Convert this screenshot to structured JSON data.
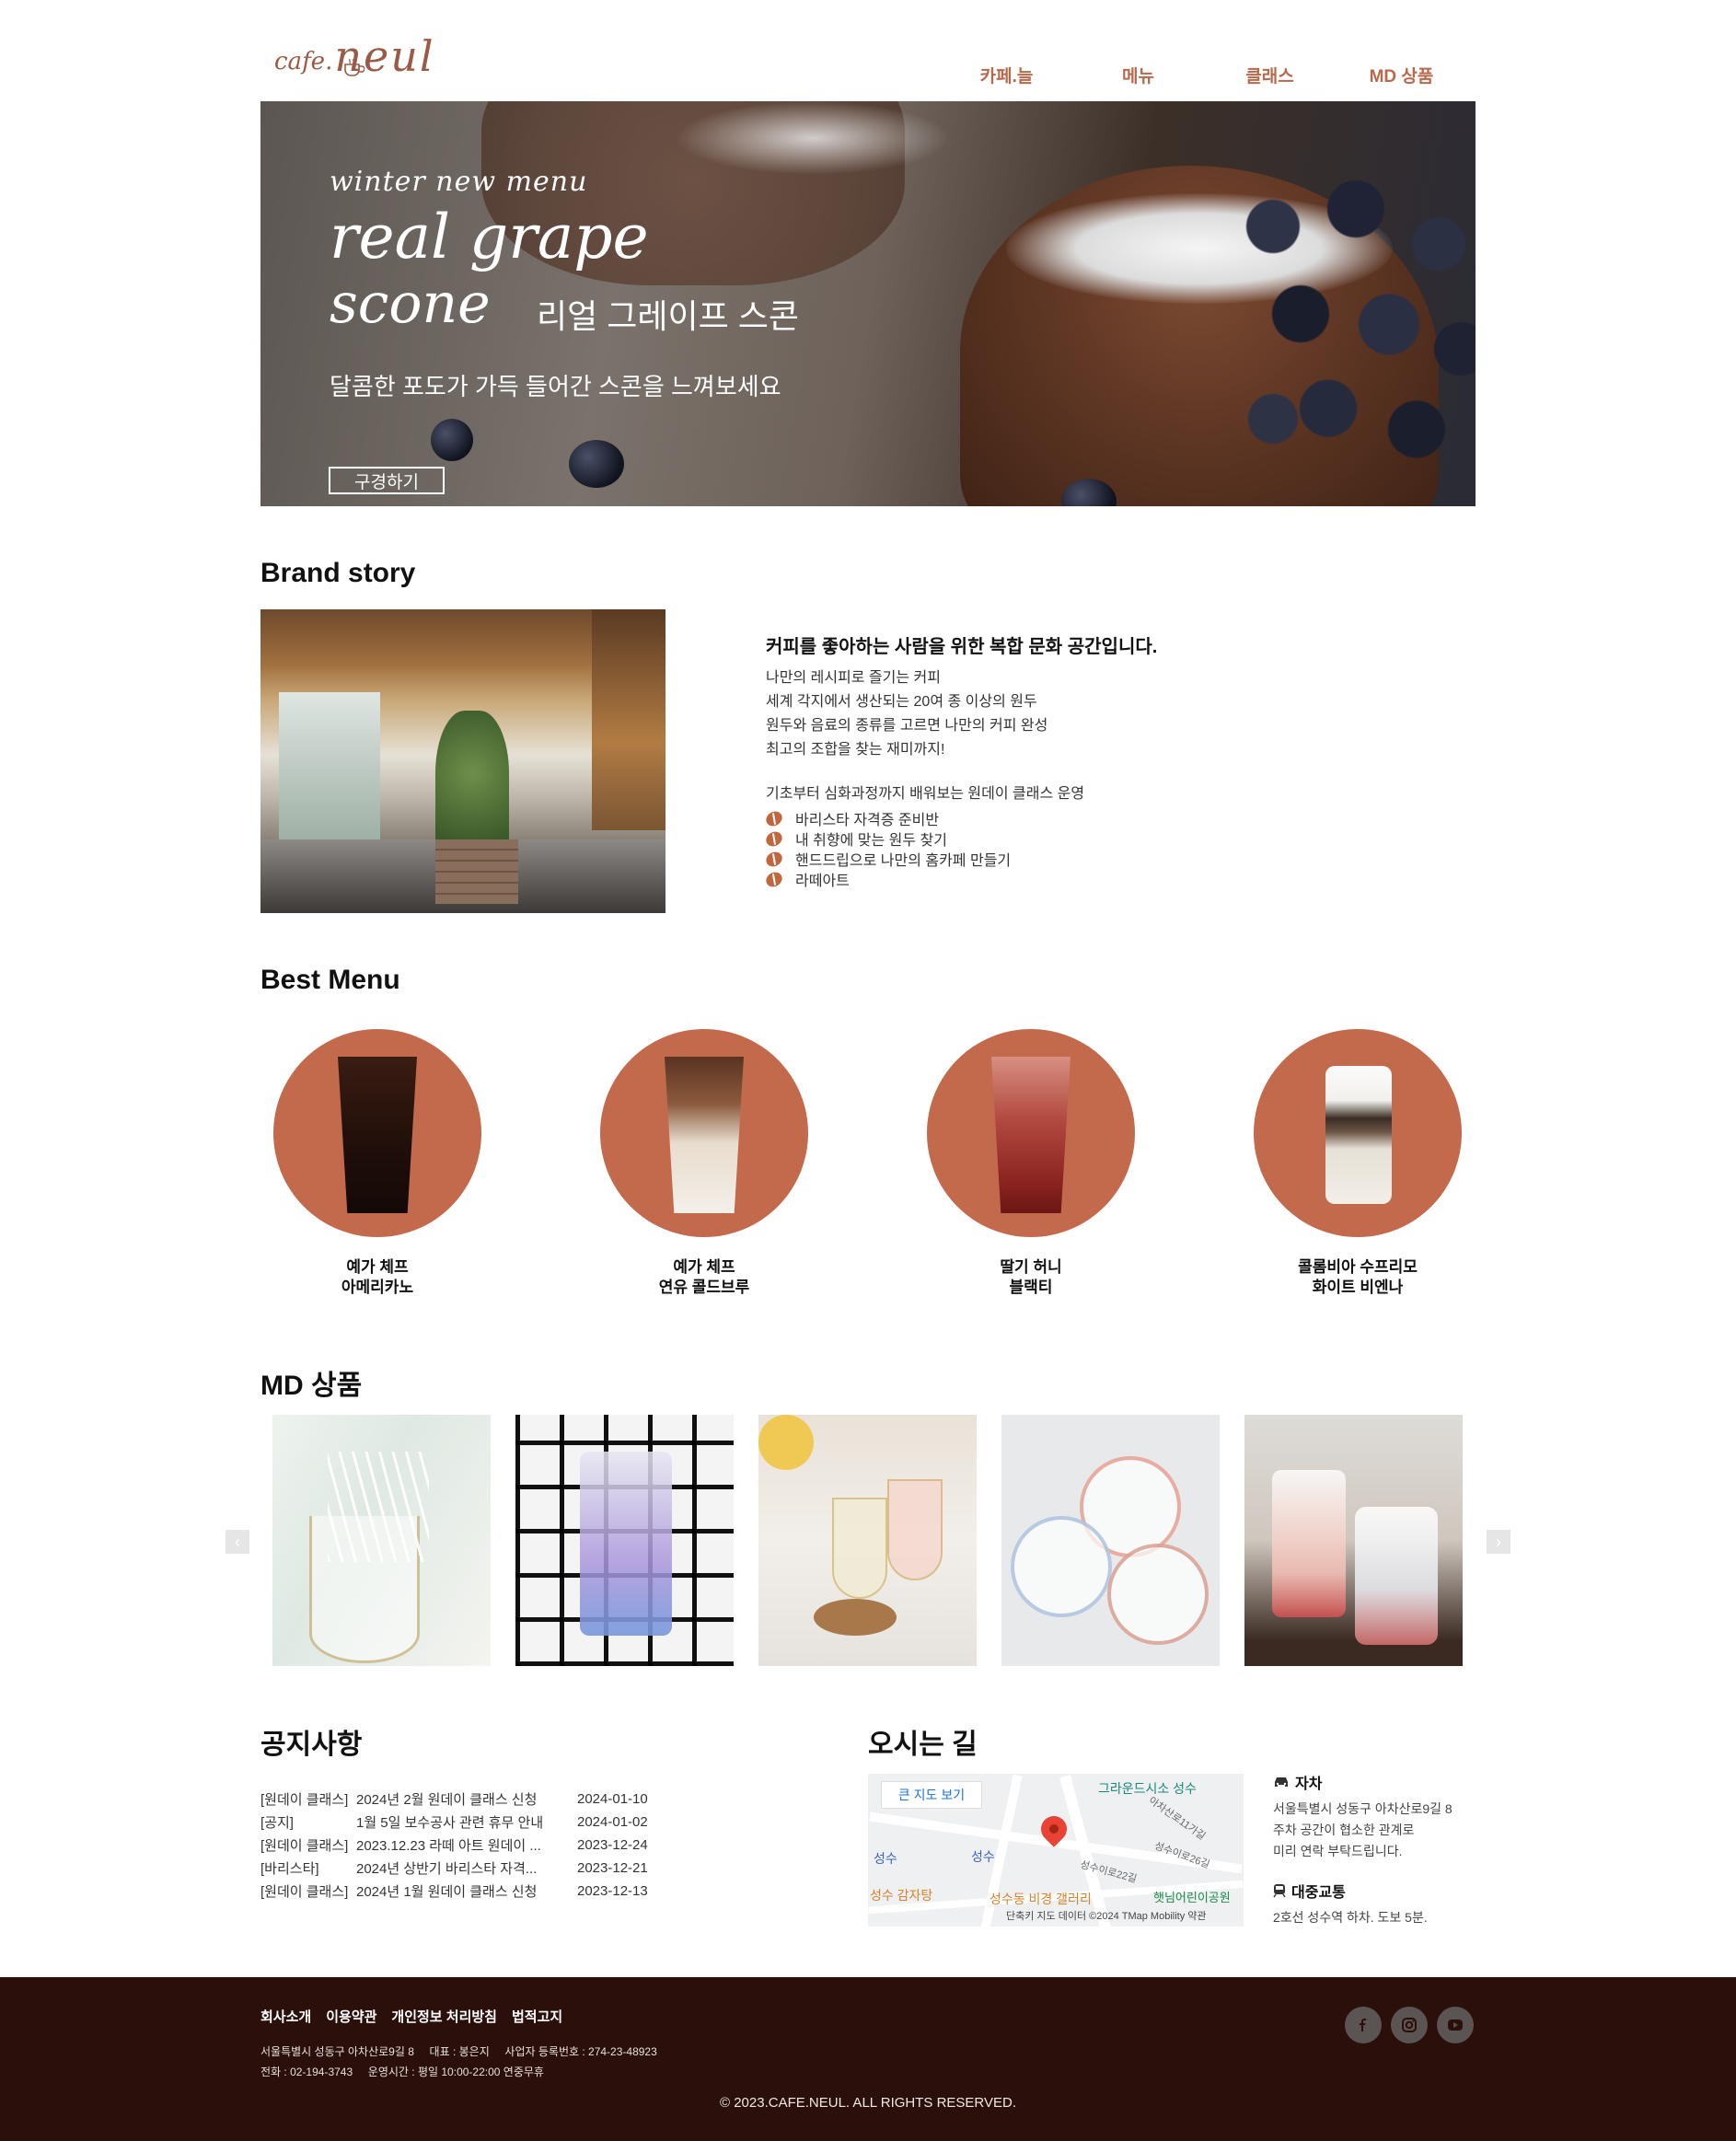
{
  "header": {
    "logo_small": "cafe.",
    "logo_big": "neul",
    "nav": [
      "카페.늘",
      "메뉴",
      "클래스",
      "MD 상품"
    ]
  },
  "hero": {
    "line1": "winter new menu",
    "line2": "real grape",
    "line3": "scone",
    "line3_ko": "리얼 그레이프 스콘",
    "subtitle": "달콤한 포도가 가득 들어간 스콘을 느껴보세요",
    "button": "구경하기"
  },
  "brand": {
    "title": "Brand story",
    "headline": "커피를 좋아하는 사람을 위한 복합 문화 공간입니다.",
    "lines": [
      "나만의 레시피로 즐기는 커피",
      "세계 각지에서 생산되는 20여 종 이상의 원두",
      "원두와 음료의 종류를 고르면 나만의 커피 완성",
      "최고의 조합을 찾는 재미까지!"
    ],
    "class_intro": "기초부터 심화과정까지 배워보는 원데이 클래스 운영",
    "classes": [
      "바리스타 자격증 준비반",
      "내 취향에 맞는 원두 찾기",
      "핸드드립으로 나만의 홈카페 만들기",
      "라떼아트"
    ]
  },
  "best_menu": {
    "title": "Best Menu",
    "items": [
      {
        "name1": "예가 체프",
        "name2": "아메리카노"
      },
      {
        "name1": "예가 체프",
        "name2": "연유 콜드브루"
      },
      {
        "name1": "딸기 허니",
        "name2": "블랙티"
      },
      {
        "name1": "콜롬비아 수프리모",
        "name2": "화이트 비엔나"
      }
    ]
  },
  "md": {
    "title": "MD 상품",
    "prev_icon": "‹",
    "next_icon": "›"
  },
  "notice": {
    "title": "공지사항",
    "rows": [
      {
        "cat": "[원데이 클래스]",
        "title": "2024년 2월 원데이 클래스 신청",
        "date": "2024-01-10"
      },
      {
        "cat": "[공지]",
        "title": "1월 5일 보수공사 관련 휴무 안내",
        "date": "2024-01-02"
      },
      {
        "cat": "[원데이 클래스]",
        "title": "2023.12.23 라떼 아트 원데이 ...",
        "date": "2023-12-24"
      },
      {
        "cat": "[바리스타]",
        "title": "2024년 상반기 바리스타 자격...",
        "date": "2023-12-21"
      },
      {
        "cat": "[원데이 클래스]",
        "title": "2024년 1월 원데이 클래스 신청",
        "date": "2023-12-13"
      }
    ]
  },
  "location": {
    "title": "오시는 길",
    "map_button": "큰 지도 보기",
    "map_labels": [
      "그라운드시소 성수",
      "성수",
      "성수",
      "성수 감자탕",
      "성수동 비경 갤러리",
      "햇님어린이공원",
      "아차산로11가길",
      "성수이로26길",
      "성수이로22길"
    ],
    "map_footer": "단축키   지도 데이터 ©2024 TMap Mobility   약관",
    "car_title": "자차",
    "car_text": [
      "서울특별시 성동구 아차산로9길 8",
      "주차 공간이 협소한 관계로",
      "미리 연락 부탁드립니다."
    ],
    "transit_title": "대중교통",
    "transit_text": "2호선 성수역 하차. 도보 5분."
  },
  "footer": {
    "links": [
      "회사소개",
      "이용약관",
      "개인정보 처리방침",
      "법적고지"
    ],
    "info1": "서울특별시 성동구 아차산로9길 8     대표 : 봉은지     사업자 등록번호 : 274-23-48923",
    "info2": "전화 : 02-194-3743     운영시간 : 평일 10:00-22:00 연중무휴",
    "copyright": "© 2023.CAFE.NEUL. ALL RIGHTS RESERVED."
  },
  "colors": {
    "accent": "#c36a4d",
    "nav": "#b9684c",
    "footer_bg": "#2a0f0b"
  }
}
